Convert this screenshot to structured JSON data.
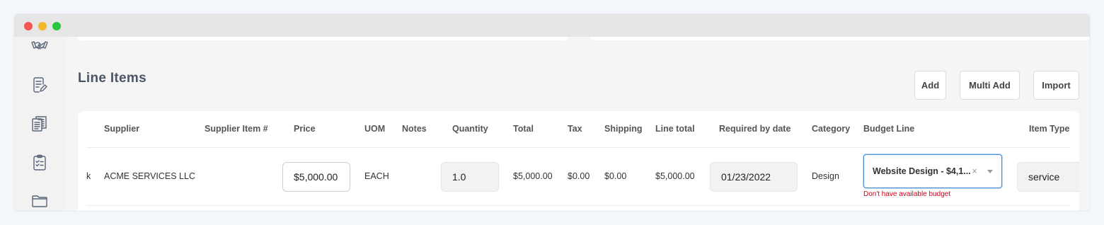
{
  "section": {
    "title": "Line Items",
    "buttons": {
      "add": "Add",
      "multi_add": "Multi Add",
      "import": "Import"
    }
  },
  "sidebar": {
    "icons": [
      "handshake-icon",
      "document-edit-icon",
      "documents-icon",
      "clipboard-check-icon",
      "folder-icon"
    ]
  },
  "table": {
    "columns": [
      "Supplier",
      "Supplier Item #",
      "Price",
      "UOM",
      "Notes",
      "Quantity",
      "Total",
      "Tax",
      "Shipping",
      "Line total",
      "Required by date",
      "Category",
      "Budget Line",
      "Item Type"
    ],
    "row": {
      "truncated_prefix": "k",
      "supplier": "ACME SERVICES LLC",
      "supplier_item": "",
      "price": "$5,000.00",
      "uom": "EACH",
      "notes": "",
      "quantity": "1.0",
      "total": "$5,000.00",
      "tax": "$0.00",
      "shipping": "$0.00",
      "line_total": "$5,000.00",
      "required_by_date": "01/23/2022",
      "category": "Design",
      "budget_line": "Website Design - $4,1...",
      "budget_error": "Don't have available budget",
      "item_type": "service"
    }
  },
  "colors": {
    "accent_border": "#4a90d9",
    "error": "#d0021b",
    "title": "#4a5568"
  }
}
